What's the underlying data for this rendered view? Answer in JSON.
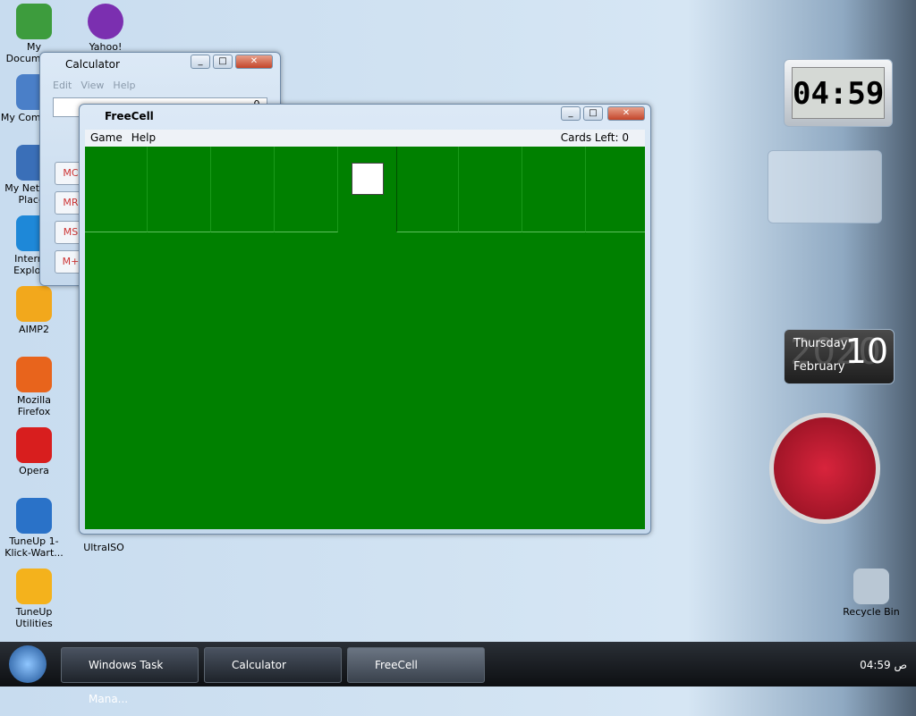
{
  "desktop_icons": [
    {
      "label": "My Documents",
      "icon": "folder-icon",
      "color": "#3d9c3d"
    },
    {
      "label": "My Computer",
      "icon": "computer-icon",
      "color": "#4a7fc8"
    },
    {
      "label": "My Network Places",
      "icon": "network-icon",
      "color": "#3a6fb8"
    },
    {
      "label": "Internet Explorer",
      "icon": "ie-icon",
      "color": "#1e88d8"
    },
    {
      "label": "AIMP2",
      "icon": "aimp-icon",
      "color": "#f2a81c"
    },
    {
      "label": "Mozilla Firefox",
      "icon": "firefox-icon",
      "color": "#e8641c"
    },
    {
      "label": "Opera",
      "icon": "opera-icon",
      "color": "#d81e1e"
    },
    {
      "label": "TuneUp 1-Klick-Wart...",
      "icon": "tuneup-icon",
      "color": "#2a72c8"
    },
    {
      "label": "TuneUp Utilities",
      "icon": "tuneup-utilities-icon",
      "color": "#f4b21c"
    }
  ],
  "ultraiso_label": "UltraISO",
  "yahoo_label": "Yahoo!",
  "calculator": {
    "title": "Calculator",
    "menu": [
      "Edit",
      "View",
      "Help"
    ],
    "display": "0.",
    "buttons": [
      "MC",
      "MR",
      "MS",
      "M+"
    ]
  },
  "freecell": {
    "title": "FreeCell",
    "menu": [
      "Game",
      "Help"
    ],
    "cards_left": "Cards Left: 0",
    "felt_color": "#008000"
  },
  "sidebar": {
    "clock_digital": "04:59",
    "calendar": {
      "day": "Thursday",
      "month": "February",
      "date": "10",
      "year": "2020"
    }
  },
  "recycle_bin": "Recycle Bin",
  "taskbar": {
    "items": [
      "Windows Task Mana...",
      "Calculator",
      "FreeCell"
    ],
    "clock": "04:59",
    "ampm": "ص"
  }
}
